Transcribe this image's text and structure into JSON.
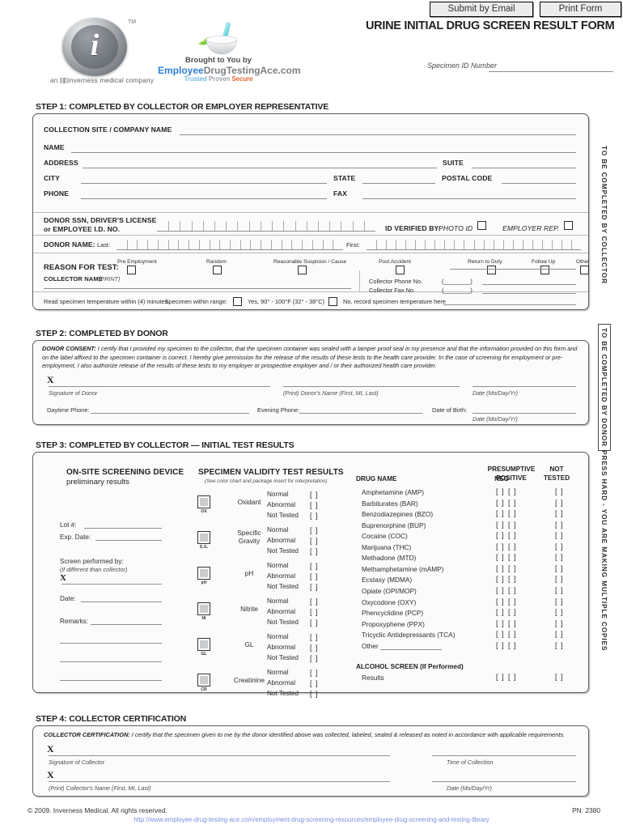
{
  "toolbar": {
    "submit_label": "Submit by Email",
    "print_label": "Print Form"
  },
  "header": {
    "title": "URINE INITIAL DRUG SCREEN RESULT FORM",
    "specimen_id_label": "Specimen ID Number",
    "logo_tm": "TM",
    "logo_glyph": "i",
    "logo_caption_pre": "an",
    "logo_caption_post": "inverness medical company",
    "sponsor_brought": "Brought to You by",
    "sponsor_name_blue": "Employee",
    "sponsor_name_gray": "DrugTestingAce",
    "sponsor_name_suffix": ".com",
    "sponsor_tag_1": "Trusted",
    "sponsor_tag_2": "Proven",
    "sponsor_tag_3": "Secure"
  },
  "side_tabs": {
    "collector": "TO BE COMPLETED BY COLLECTOR",
    "donor": "TO BE COMPLETED BY DONOR",
    "press": "PRESS HARD - YOU ARE MAKING MULTIPLE COPIES"
  },
  "step1": {
    "heading": "STEP 1: COMPLETED BY COLLECTOR OR EMPLOYER REPRESENTATIVE",
    "collection_site": "COLLECTION SITE / COMPANY NAME",
    "name": "NAME",
    "address": "ADDRESS",
    "suite": "SUITE",
    "city": "CITY",
    "state": "STATE",
    "postal_code": "POSTAL CODE",
    "phone": "PHONE",
    "fax": "FAX",
    "ssn_line1": "DONOR SSN, DRIVER'S LICENSE",
    "ssn_line2": "or EMPLOYEE I.D. NO.",
    "id_verified_by": "ID VERIFIED BY:",
    "photo_id": "PHOTO ID",
    "employer_rep": "EMPLOYER REP.",
    "donor_name": "DONOR NAME:",
    "last": "Last:",
    "first": "First:",
    "reason_for_test": "REASON FOR TEST:",
    "reasons": [
      "Pre Employment",
      "Random",
      "Reasonable Suspicion / Cause",
      "Post Accident",
      "Return to Duty",
      "Follow Up",
      "Other"
    ],
    "collector_name": "COLLECTOR NAME",
    "collector_name_print": "(PRINT)",
    "collector_phone": "Collector Phone No.",
    "collector_fax": "Collector Fax No.",
    "temp_instruction": "Read specimen temperature within (4) minutes.",
    "temp_within_range": "Specimen within range:",
    "temp_yes": "Yes, 90° - 100°F (32° - 38°C)",
    "temp_no": "No, record specimen temperature here"
  },
  "step2": {
    "heading": "STEP 2: COMPLETED BY DONOR",
    "consent_label": "DONOR CONSENT:",
    "consent_text": " I certify that I provided my specimen to the collector, that the specimen container was sealed with a tamper proof seal in my presence and that the information provided on this form and on the label affixed to the specimen container is correct. I hereby give permission for the release of the results of these tests to the health care provider. In the case of screening for employment or pre-employment, I also authorize release of the results of these tests to my employer or prospective employer and / or their authorized health care provider.",
    "x_mark": "X",
    "sig_donor": "Signature of Donor",
    "print_donor_name": "(Print) Donor's Name (First, MI, Last)",
    "date_label": "Date (Mo/Day/Yr)",
    "daytime_phone": "Daytime Phone:",
    "evening_phone": "Evening Phone:",
    "date_of_birth": "Date of Birth:",
    "dob_format": "Date (Mo/Day/Yr)"
  },
  "step3": {
    "heading": "STEP 3: COMPLETED BY COLLECTOR — INITIAL TEST RESULTS",
    "device_title": "ON-SITE SCREENING DEVICE",
    "device_subtitle": "preliminary results",
    "lot": "Lot #:",
    "exp_date": "Exp. Date:",
    "screen_performed_by": "Screen performed by:",
    "screen_performed_note": "(if different than collector)",
    "x_mark": "X",
    "date": "Date:",
    "remarks": "Remarks:",
    "validity_title": "SPECIMEN VALIDITY TEST RESULTS",
    "validity_subtitle": "(See color chart and package insert for interpretation)",
    "validity_rows": [
      {
        "name": "Oxidant",
        "code": "OX"
      },
      {
        "name": "Specific Gravity",
        "code": "S.G."
      },
      {
        "name": "pH",
        "code": "pH"
      },
      {
        "name": "Nitrite",
        "code": "NI"
      },
      {
        "name": "GL",
        "code": "GL"
      },
      {
        "name": "Creatinine",
        "code": "CR"
      }
    ],
    "validity_results": [
      "Normal",
      "Abnormal",
      "Not Tested"
    ],
    "bracket": "[  ]",
    "drug_name_header": "DRUG NAME",
    "neg_header": "NEG",
    "presumptive_header_1": "PRESUMPTIVE",
    "presumptive_header_2": "POSITIVE",
    "not_header_1": "NOT",
    "not_header_2": "TESTED",
    "drugs": [
      "Amphetamine (AMP)",
      "Barbiturates (BAR)",
      "Benzodiazepines (BZO)",
      "Buprenorphine (BUP)",
      "Cocaine (COC)",
      "Marijuana (THC)",
      "Methadone (MTD)",
      "Methamphetamine (mAMP)",
      "Ecstasy (MDMA)",
      "Opiate (OPI/MOP)",
      "Oxycodone (OXY)",
      "Phencyclidine (PCP)",
      "Propoxyphene (PPX)",
      "Tricyclic Antidepressants  (TCA)"
    ],
    "other_label": "Other",
    "alcohol_title": "ALCOHOL SCREEN (If Performed)",
    "alcohol_results": "Results"
  },
  "step4": {
    "heading": "STEP 4: COLLECTOR CERTIFICATION",
    "cert_label": "COLLECTOR CERTIFICATION:",
    "cert_text": "  I certify that the specimen given to me by the donor identified above was collected, labeled, sealed & released as noted in accordance with applicable requirements.",
    "x_mark": "X",
    "sig_collector": "Signature of Collector",
    "time_of_collection": "Time of Collection",
    "print_collector_name": "(Print) Collector's Name (First, MI, Last)",
    "date_label": "Date (Mo/Day/Yr)"
  },
  "footer": {
    "copyright": "© 2009. Inverness Medical. All rights reserved.",
    "pn": "PN: 2380",
    "url": "http://www.employee-drug-testing-ace.com/employment-drug-screening-resources/employee-drug-screening-and-testing-library"
  }
}
